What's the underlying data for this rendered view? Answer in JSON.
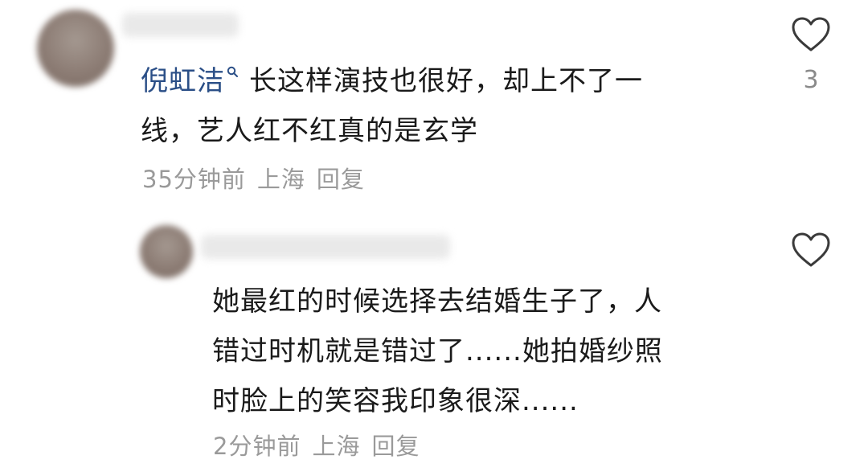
{
  "comments": [
    {
      "mention": "倪虹洁",
      "text_line1": "长这样演技也很好，却上不了一",
      "text_line2": "线，艺人红不红真的是玄学",
      "meta": {
        "time": "35分钟前",
        "location": "上海",
        "reply": "回复"
      },
      "likes": "3",
      "icon": "heart-outline-icon"
    },
    {
      "text_line1": "她最红的时候选择去结婚生子了，人",
      "text_line2": "错过时机就是错过了......她拍婚纱照",
      "text_line3": "时脸上的笑容我印象很深......",
      "meta": {
        "time": "2分钟前",
        "location": "上海",
        "reply": "回复"
      },
      "icon": "heart-outline-icon"
    }
  ],
  "colors": {
    "mention": "#2b4f87",
    "text": "#1a1a1a",
    "meta": "#9a9a9a",
    "icon": "#3a3a3a"
  }
}
